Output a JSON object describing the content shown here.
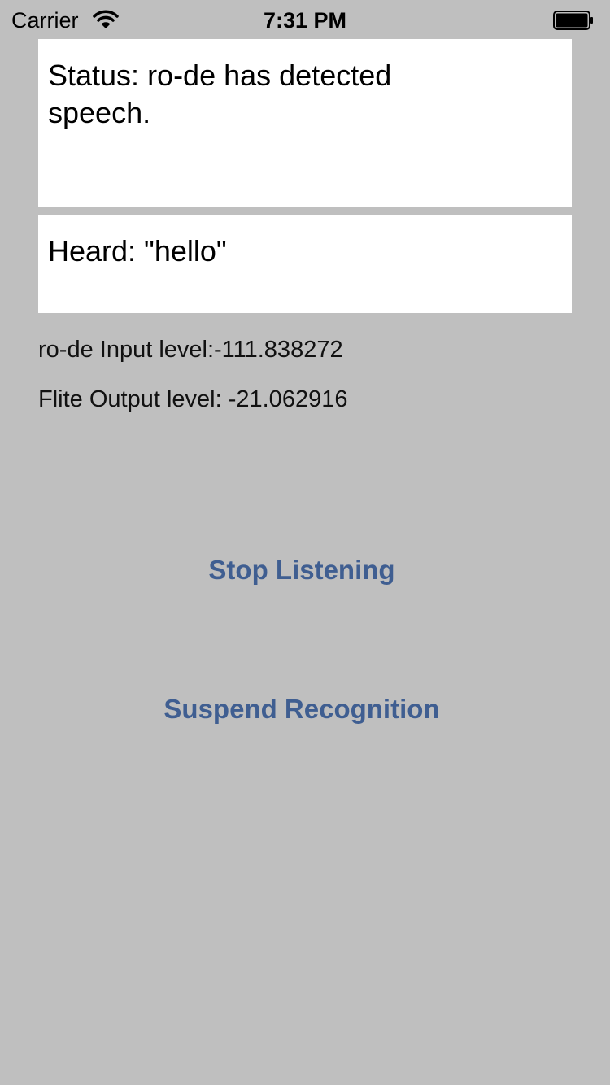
{
  "status_bar": {
    "carrier": "Carrier",
    "time": "7:31 PM",
    "wifi_icon": "wifi-icon",
    "battery_icon": "battery-icon"
  },
  "status_panel": {
    "text": "Status: ro-de has detected speech."
  },
  "heard_panel": {
    "text": "Heard: \"hello\""
  },
  "levels": {
    "input": "ro-de Input level:-111.838272",
    "output": "Flite Output level: -21.062916"
  },
  "buttons": {
    "stop_listening": "Stop Listening",
    "suspend_recognition": "Suspend Recognition"
  },
  "colors": {
    "background": "#bfbfbf",
    "panel": "#ffffff",
    "button_text": "#3f5e91"
  }
}
